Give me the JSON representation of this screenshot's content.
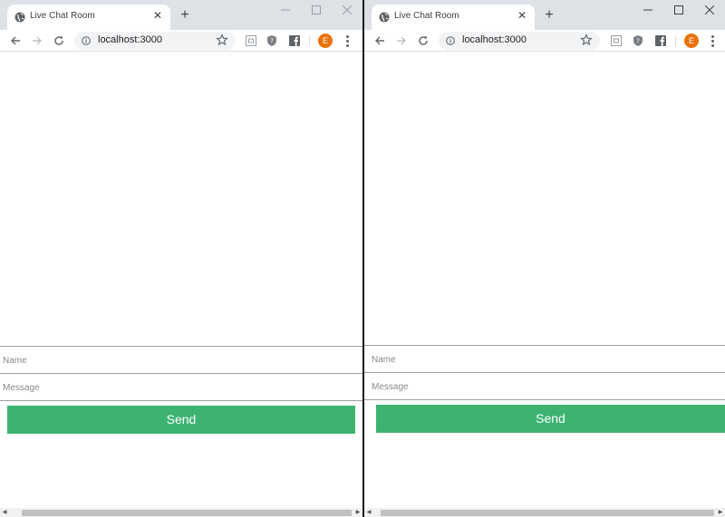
{
  "windows": [
    {
      "tab_title": "Live Chat Room",
      "url": "localhost:3000",
      "avatar_letter": "E",
      "name_placeholder": "Name",
      "message_placeholder": "Message",
      "send_label": "Send"
    },
    {
      "tab_title": "Live Chat Room",
      "url": "localhost:3000",
      "avatar_letter": "E",
      "name_placeholder": "Name",
      "message_placeholder": "Message",
      "send_label": "Send"
    }
  ],
  "colors": {
    "send_button": "#3cb371",
    "avatar": "#e8710a",
    "tab_strip": "#dee1e6"
  },
  "icons": [
    "globe-icon",
    "close-icon",
    "plus-icon",
    "minimize-icon",
    "maximize-icon",
    "back-icon",
    "forward-icon",
    "reload-icon",
    "info-icon",
    "star-icon",
    "extension-icon",
    "shield-icon",
    "facebook-icon",
    "menu-icon"
  ]
}
